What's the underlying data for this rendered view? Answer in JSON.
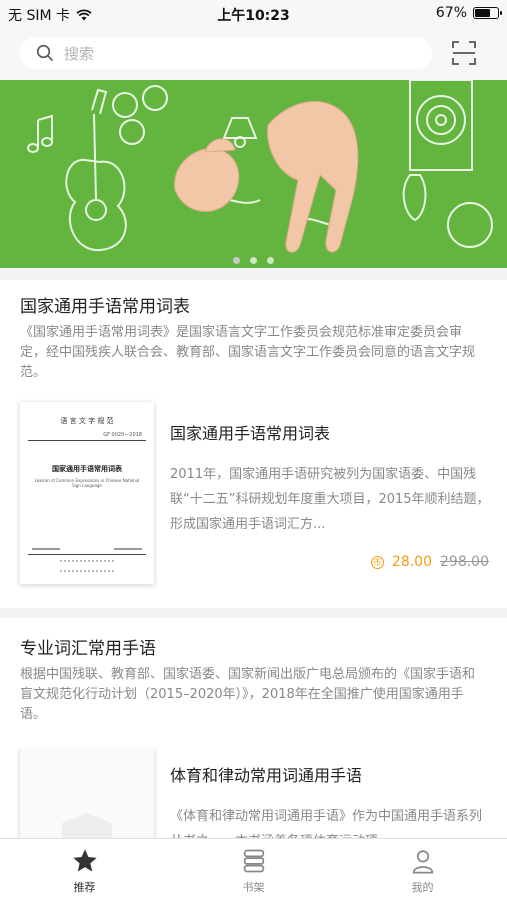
{
  "status_bar": {
    "carrier": "无 SIM 卡",
    "time": "上午10:23",
    "battery_percent": "67%",
    "battery_level": 0.67
  },
  "search": {
    "placeholder": "搜索"
  },
  "banner": {
    "slide_count": 3,
    "active_index": 0,
    "background_color": "#63b53f"
  },
  "sections": [
    {
      "title": "国家通用手语常用词表",
      "description": "《国家通用手语常用词表》是国家语言文字工作委员会规范标准审定委员会审定，经中国残疾人联合会、教育部、国家语言文字工作委员会同意的语言文字规范。",
      "book": {
        "cover": {
          "header": "语 言 文 字 规 范",
          "code": "GF 0020—2018",
          "title": "国家通用手语常用词表",
          "subtitle": "Lexicon of Common Expressions in Chinese National Sign Language"
        },
        "title": "国家通用手语常用词表",
        "description": "2011年，国家通用手语研究被列为国家语委、中国残联“十二五”科研规划年度重大项目，2015年顺利结题，形成国家通用手语词汇方...",
        "price": "28.00",
        "original_price": "298.00"
      }
    },
    {
      "title": "专业词汇常用手语",
      "description": "根据中国残联、教育部、国家语委、国家新闻出版广电总局颁布的《国家手语和盲文规范化行动计划（2015–2020年）》，2018年在全国推广使用国家通用手语。",
      "book": {
        "title": "体育和律动常用词通用手语",
        "description": "《体育和律动常用词通用手语》作为中国通用手语系列丛书之一，本书涵盖各项体育运动项"
      }
    }
  ],
  "tab_bar": {
    "tabs": [
      {
        "label": "推荐",
        "icon": "star-icon",
        "active": true
      },
      {
        "label": "书架",
        "icon": "bookshelf-icon",
        "active": false
      },
      {
        "label": "我的",
        "icon": "user-icon",
        "active": false
      }
    ]
  },
  "colors": {
    "accent": "#f39c12",
    "banner_green": "#63b53f"
  }
}
